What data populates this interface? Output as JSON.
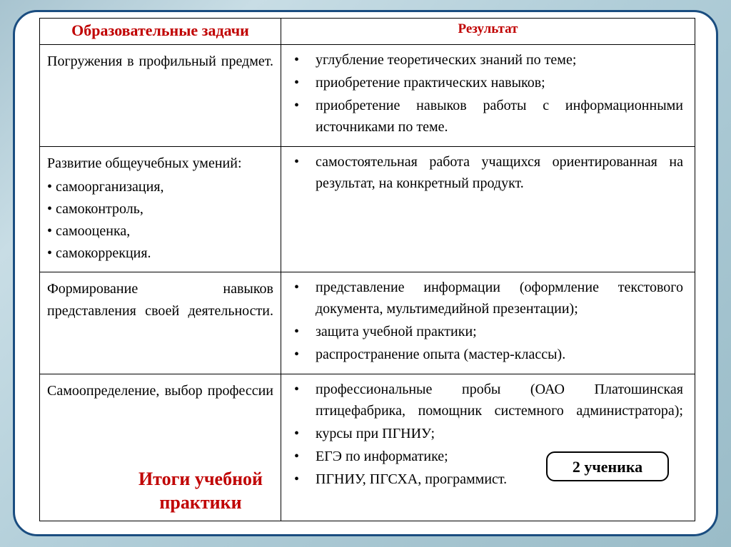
{
  "headers": {
    "tasks": "Образовательные задачи",
    "result": "Результат"
  },
  "row1": {
    "task": "Погружения в профильный предмет.",
    "results": [
      "углубление теоретических знаний по теме;",
      "приобретение практических навыков;",
      "приобретение навыков работы с информационными источниками по теме."
    ]
  },
  "row2": {
    "intro": "Развитие общеучебных умений:",
    "items": [
      "самоорганизация,",
      "самоконтроль,",
      "самооценка,",
      "самокоррекция."
    ],
    "results": [
      "самостоятельная работа учащихся ориентированная на результат, на конкретный продукт."
    ]
  },
  "row3": {
    "task": "Формирование навыков представления своей деятельности.",
    "results": [
      "представление информации (оформление текстового документа, мультимедийной презентации);",
      "защита учебной практики;",
      "распространение опыта (мастер-классы)."
    ]
  },
  "row4": {
    "task": "Самоопределение, выбор профессии",
    "results": [
      "профессиональные пробы (ОАО Платошинская птицефабрика, помощник системного администратора);",
      "курсы при ПГНИУ;",
      "ЕГЭ по информатике;",
      "ПГНИУ, ПГСХА, программист."
    ]
  },
  "footer_title": "Итоги учебной практики",
  "badge": "2 ученика"
}
